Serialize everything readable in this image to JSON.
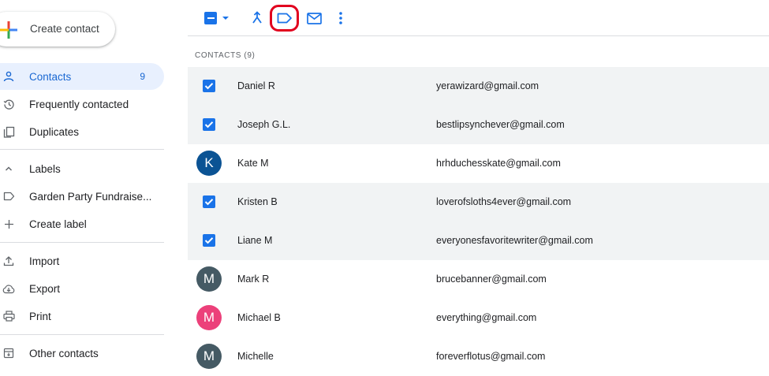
{
  "sidebar": {
    "create_label": "Create contact",
    "nav": [
      {
        "label": "Contacts",
        "icon": "person-icon",
        "count": "9",
        "active": true
      },
      {
        "label": "Frequently contacted",
        "icon": "history-icon"
      },
      {
        "label": "Duplicates",
        "icon": "duplicates-icon"
      },
      {
        "label": "Labels",
        "icon": "chevron-up-icon"
      },
      {
        "label": "Garden Party Fundraise...",
        "icon": "label-icon"
      },
      {
        "label": "Create label",
        "icon": "plus-icon"
      },
      {
        "label": "Import",
        "icon": "upload-icon"
      },
      {
        "label": "Export",
        "icon": "cloud-download-icon"
      },
      {
        "label": "Print",
        "icon": "print-icon"
      },
      {
        "label": "Other contacts",
        "icon": "archive-icon"
      }
    ]
  },
  "list": {
    "heading": "CONTACTS (9)",
    "rows": [
      {
        "name": "Daniel R",
        "email": "yerawizard@gmail.com",
        "selected": true
      },
      {
        "name": "Joseph G.L.",
        "email": "bestlipsynchever@gmail.com",
        "selected": true
      },
      {
        "name": "Kate M",
        "email": "hrhduchesskate@gmail.com",
        "selected": false,
        "initial": "K",
        "color": "#0b5394"
      },
      {
        "name": "Kristen B",
        "email": "loverofsloths4ever@gmail.com",
        "selected": true
      },
      {
        "name": "Liane M",
        "email": "everyonesfavoritewriter@gmail.com",
        "selected": true
      },
      {
        "name": "Mark R",
        "email": "brucebanner@gmail.com",
        "selected": false,
        "initial": "M",
        "color": "#455a64"
      },
      {
        "name": "Michael B",
        "email": "everything@gmail.com",
        "selected": false,
        "initial": "M",
        "color": "#ec407a"
      },
      {
        "name": "Michelle",
        "email": "foreverflotus@gmail.com",
        "selected": false,
        "initial": "M",
        "color": "#455a64"
      }
    ]
  },
  "colors": {
    "accent": "#1a73e8",
    "highlight": "#e1001e"
  }
}
